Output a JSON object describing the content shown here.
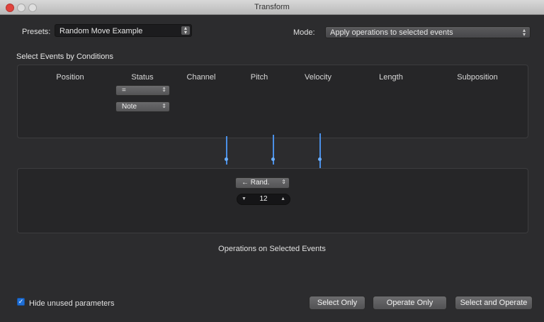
{
  "window": {
    "title": "Transform"
  },
  "presets": {
    "label": "Presets:",
    "value": "Random Move Example"
  },
  "mode": {
    "label": "Mode:",
    "value": "Apply operations to selected events"
  },
  "conditions": {
    "title": "Select Events by Conditions",
    "columns": [
      "Position",
      "Status",
      "Channel",
      "Pitch",
      "Velocity",
      "Length",
      "Subposition"
    ],
    "status_operator": "=",
    "status_value": "Note"
  },
  "operation": {
    "type": "← Rand.",
    "value": "12"
  },
  "operations_caption": "Operations on Selected Events",
  "footer": {
    "hide_unused_label": "Hide unused parameters",
    "hide_unused_checked": true,
    "select_only": "Select Only",
    "operate_only": "Operate Only",
    "select_and_operate": "Select and Operate"
  },
  "colors": {
    "accent": "#4a8fe6",
    "background": "#2c2c2e",
    "panel": "#262628"
  },
  "icons": [
    "close-icon",
    "minimize-icon",
    "zoom-icon",
    "stepper-icon",
    "dropdown-arrow-icon",
    "checkmark-icon"
  ]
}
